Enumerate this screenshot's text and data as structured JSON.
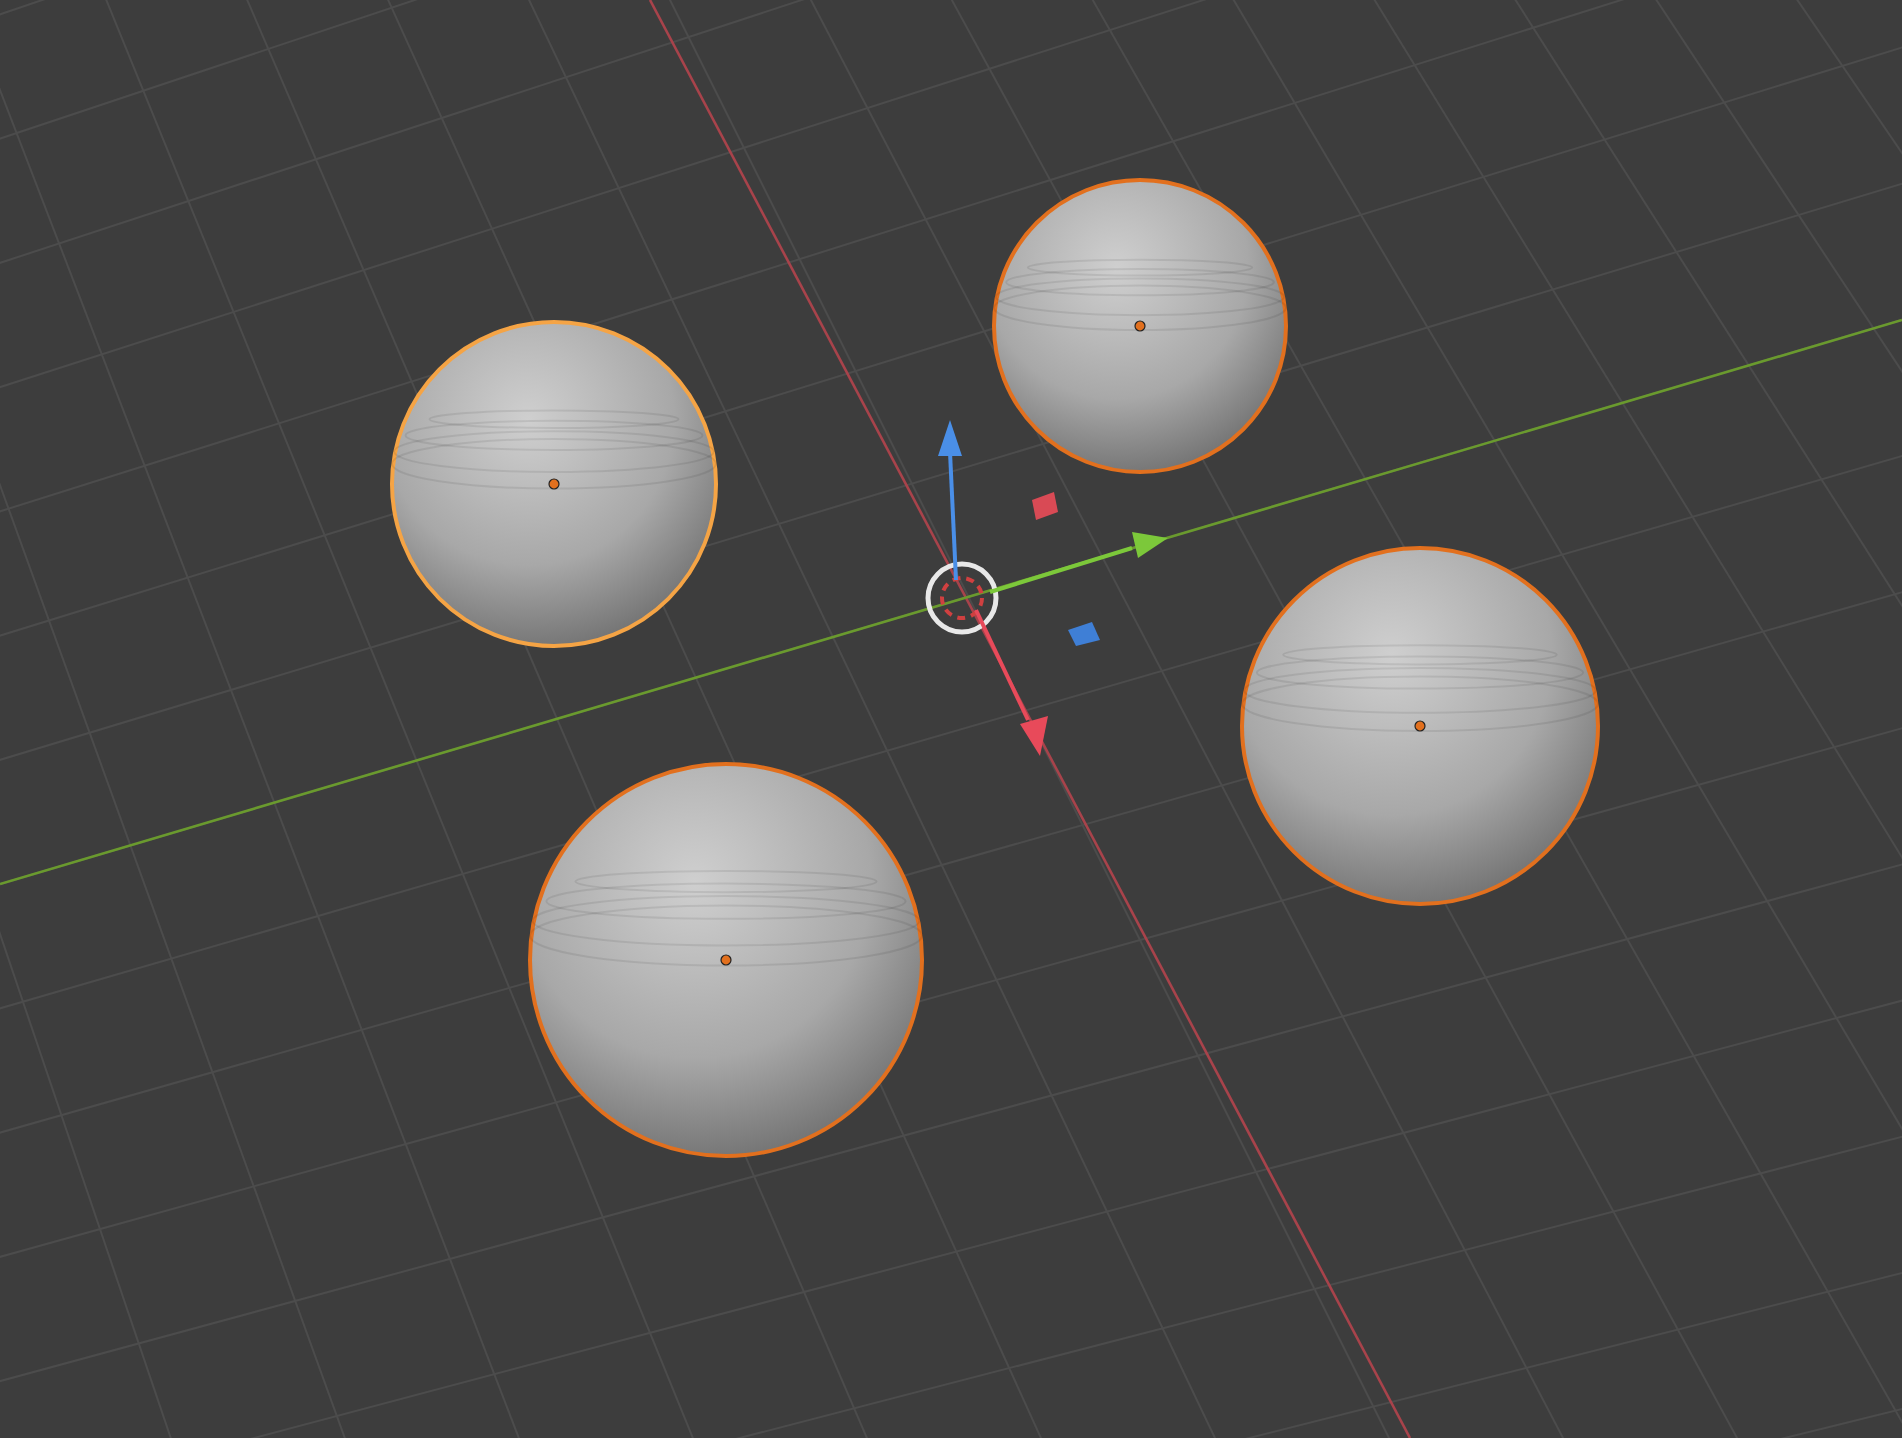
{
  "viewport": {
    "objects": [
      {
        "kind": "sphere",
        "selected": true,
        "active": false
      },
      {
        "kind": "sphere",
        "selected": true,
        "active": true
      },
      {
        "kind": "sphere",
        "selected": true,
        "active": false
      },
      {
        "kind": "sphere",
        "selected": true,
        "active": false
      }
    ],
    "gizmo": {
      "kind": "move"
    }
  }
}
